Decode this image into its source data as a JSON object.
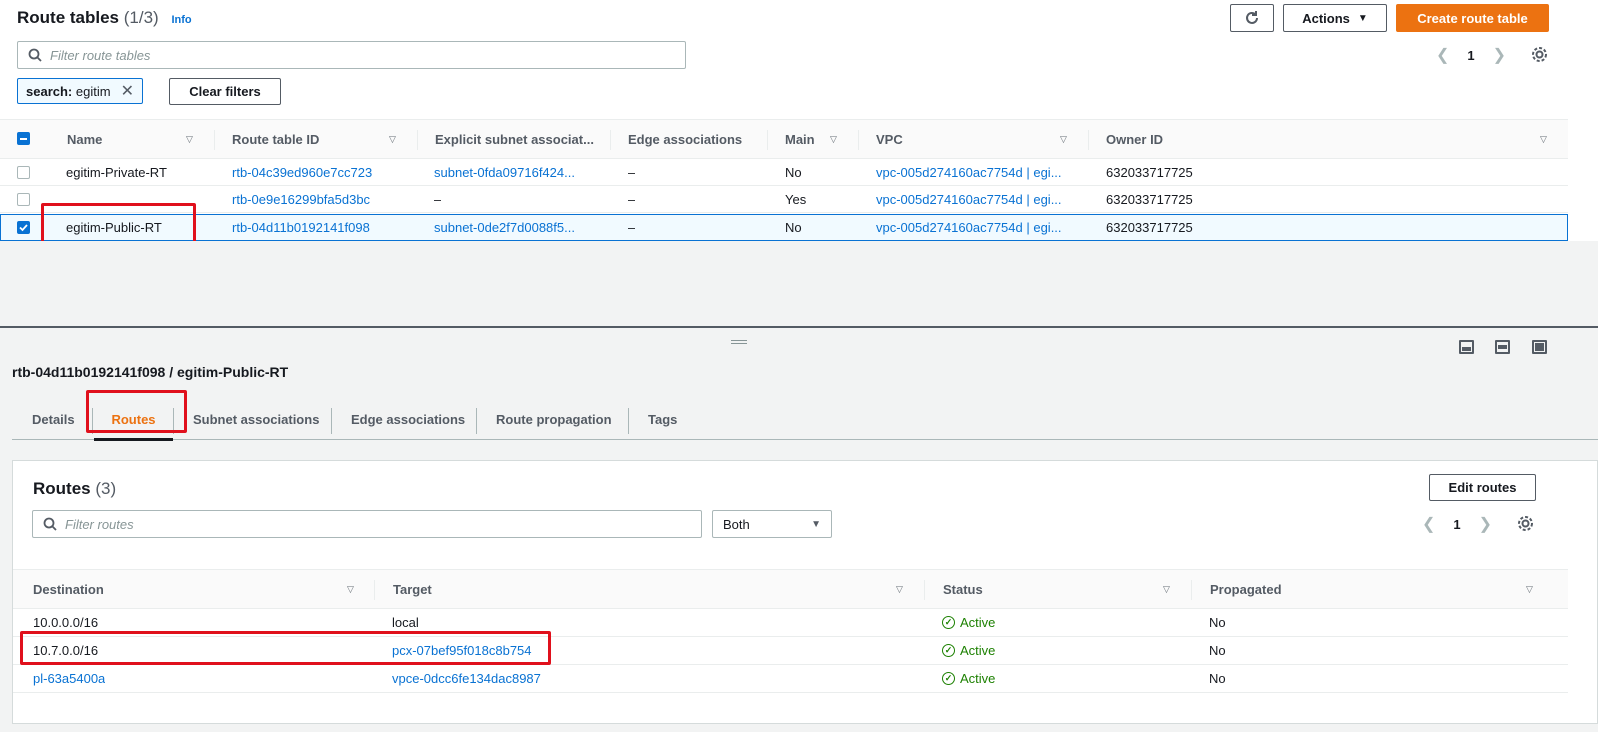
{
  "header": {
    "title": "Route tables",
    "count": "(1/3)",
    "info": "Info",
    "actions_label": "Actions",
    "create_label": "Create route table"
  },
  "filter": {
    "placeholder": "Filter route tables",
    "token_key": "search:",
    "token_value": "egitim",
    "clear_label": "Clear filters"
  },
  "pager": {
    "page": "1"
  },
  "route_tables": {
    "columns": [
      "Name",
      "Route table ID",
      "Explicit subnet associat...",
      "Edge associations",
      "Main",
      "VPC",
      "Owner ID"
    ],
    "rows": [
      {
        "name": "egitim-Private-RT",
        "id": "rtb-04c39ed960e7cc723",
        "subnet": "subnet-0fda09716f424...",
        "edge": "–",
        "main": "No",
        "vpc": "vpc-005d274160ac7754d | egi...",
        "owner": "632033717725",
        "selected": false
      },
      {
        "name": "",
        "id": "rtb-0e9e16299bfa5d3bc",
        "subnet": "–",
        "edge": "–",
        "main": "Yes",
        "vpc": "vpc-005d274160ac7754d | egi...",
        "owner": "632033717725",
        "selected": false
      },
      {
        "name": "egitim-Public-RT",
        "id": "rtb-04d11b0192141f098",
        "subnet": "subnet-0de2f7d0088f5...",
        "edge": "–",
        "main": "No",
        "vpc": "vpc-005d274160ac7754d | egi...",
        "owner": "632033717725",
        "selected": true
      }
    ]
  },
  "detail": {
    "title": "rtb-04d11b0192141f098 / egitim-Public-RT",
    "tabs": [
      "Details",
      "Routes",
      "Subnet associations",
      "Edge associations",
      "Route propagation",
      "Tags"
    ],
    "active_tab": "Routes"
  },
  "routes": {
    "title": "Routes",
    "count": "(3)",
    "edit_label": "Edit routes",
    "filter_placeholder": "Filter routes",
    "select_value": "Both",
    "page": "1",
    "columns": [
      "Destination",
      "Target",
      "Status",
      "Propagated"
    ],
    "rows": [
      {
        "destination": "10.0.0.0/16",
        "target": "local",
        "status": "Active",
        "propagated": "No"
      },
      {
        "destination": "10.7.0.0/16",
        "target": "pcx-07bef95f018c8b754",
        "status": "Active",
        "propagated": "No"
      },
      {
        "destination": "pl-63a5400a",
        "target": "vpce-0dcc6fe134dac8987",
        "status": "Active",
        "propagated": "No"
      }
    ]
  },
  "colors": {
    "primary": "#ec7211",
    "link": "#0972d3",
    "success": "#1d8102",
    "highlight": "#e0101c"
  }
}
